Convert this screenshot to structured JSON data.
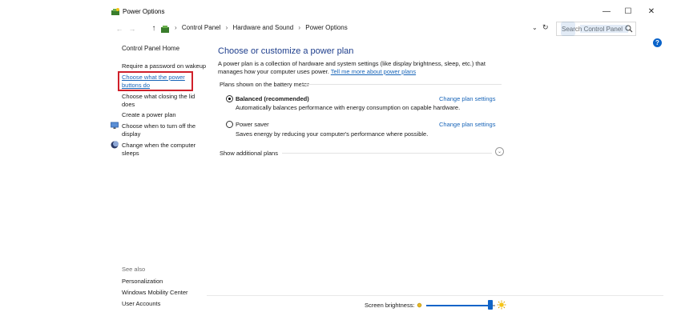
{
  "window": {
    "title": "Power Options",
    "controls": {
      "minimize": "—",
      "maximize": "☐",
      "close": "✕"
    }
  },
  "addressbar": {
    "back": "←",
    "forward": "→",
    "up": "↑",
    "crumbs": [
      "Control Panel",
      "Hardware and Sound",
      "Power Options"
    ],
    "separator": "›",
    "dropdown": "⌄",
    "refresh": "↻",
    "search_placeholder": "Search Control Panel"
  },
  "help": {
    "label": "?"
  },
  "sidebar": {
    "home": "Control Panel Home",
    "items": [
      {
        "label": "Require a password on wakeup",
        "link": false
      },
      {
        "label": "Choose what the power buttons do",
        "link": true,
        "highlighted": true
      },
      {
        "label": "Choose what closing the lid does",
        "link": false
      },
      {
        "label": "Create a power plan",
        "link": false
      },
      {
        "label": "Choose when to turn off the display",
        "link": false,
        "icon": "monitor-icon"
      },
      {
        "label": "Change when the computer sleeps",
        "link": false,
        "icon": "moon-icon"
      }
    ],
    "see_also": {
      "heading": "See also",
      "links": [
        "Personalization",
        "Windows Mobility Center",
        "User Accounts"
      ]
    }
  },
  "main": {
    "title": "Choose or customize a power plan",
    "description": "A power plan is a collection of hardware and system settings (like display brightness, sleep, etc.) that manages how your computer uses power.",
    "learn_more": "Tell me more about power plans",
    "section_label": "Plans shown on the battery meter",
    "plans": [
      {
        "name": "Balanced (recommended)",
        "description": "Automatically balances performance with energy consumption on capable hardware.",
        "selected": true,
        "change_label": "Change plan settings"
      },
      {
        "name": "Power saver",
        "description": "Saves energy by reducing your computer's performance where possible.",
        "selected": false,
        "change_label": "Change plan settings"
      }
    ],
    "show_additional": "Show additional plans",
    "expand_glyph": "⌄"
  },
  "brightness": {
    "label": "Screen brightness:",
    "level": 0.93
  },
  "colors": {
    "link": "#1764b8",
    "title": "#1e3e8c",
    "highlight_border": "#d0202a",
    "slider": "#1064c8"
  }
}
